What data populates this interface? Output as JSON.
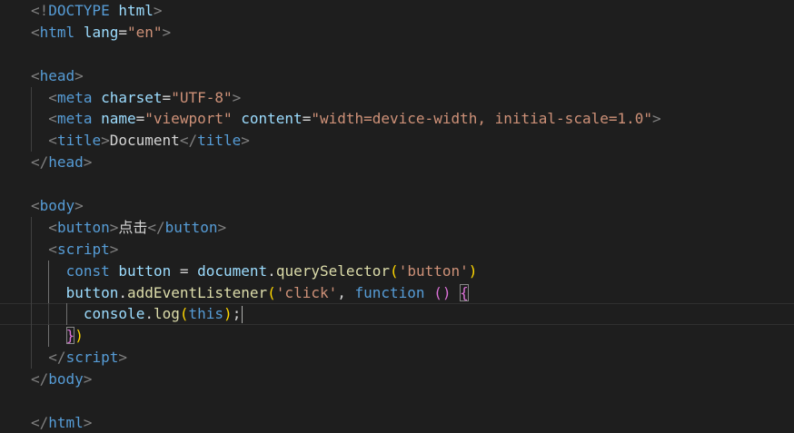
{
  "editor": {
    "lines": [
      {
        "indent": 0,
        "tokens": [
          {
            "t": "<!",
            "c": "tag-bracket"
          },
          {
            "t": "DOCTYPE",
            "c": "tag"
          },
          {
            "t": " ",
            "c": "txt"
          },
          {
            "t": "html",
            "c": "attr"
          },
          {
            "t": ">",
            "c": "tag-bracket"
          }
        ]
      },
      {
        "indent": 0,
        "tokens": [
          {
            "t": "<",
            "c": "tag-bracket"
          },
          {
            "t": "html",
            "c": "tag"
          },
          {
            "t": " ",
            "c": "txt"
          },
          {
            "t": "lang",
            "c": "attr"
          },
          {
            "t": "=",
            "c": "pun"
          },
          {
            "t": "\"en\"",
            "c": "str"
          },
          {
            "t": ">",
            "c": "tag-bracket"
          }
        ]
      },
      {
        "indent": 0,
        "tokens": []
      },
      {
        "indent": 0,
        "tokens": [
          {
            "t": "<",
            "c": "tag-bracket"
          },
          {
            "t": "head",
            "c": "tag"
          },
          {
            "t": ">",
            "c": "tag-bracket"
          }
        ]
      },
      {
        "indent": 1,
        "tokens": [
          {
            "t": "<",
            "c": "tag-bracket"
          },
          {
            "t": "meta",
            "c": "tag"
          },
          {
            "t": " ",
            "c": "txt"
          },
          {
            "t": "charset",
            "c": "attr"
          },
          {
            "t": "=",
            "c": "pun"
          },
          {
            "t": "\"UTF-8\"",
            "c": "str"
          },
          {
            "t": ">",
            "c": "tag-bracket"
          }
        ]
      },
      {
        "indent": 1,
        "tokens": [
          {
            "t": "<",
            "c": "tag-bracket"
          },
          {
            "t": "meta",
            "c": "tag"
          },
          {
            "t": " ",
            "c": "txt"
          },
          {
            "t": "name",
            "c": "attr"
          },
          {
            "t": "=",
            "c": "pun"
          },
          {
            "t": "\"viewport\"",
            "c": "str"
          },
          {
            "t": " ",
            "c": "txt"
          },
          {
            "t": "content",
            "c": "attr"
          },
          {
            "t": "=",
            "c": "pun"
          },
          {
            "t": "\"width=device-width, initial-scale=1.0\"",
            "c": "str"
          },
          {
            "t": ">",
            "c": "tag-bracket"
          }
        ]
      },
      {
        "indent": 1,
        "tokens": [
          {
            "t": "<",
            "c": "tag-bracket"
          },
          {
            "t": "title",
            "c": "tag"
          },
          {
            "t": ">",
            "c": "tag-bracket"
          },
          {
            "t": "Document",
            "c": "txt"
          },
          {
            "t": "</",
            "c": "tag-bracket"
          },
          {
            "t": "title",
            "c": "tag"
          },
          {
            "t": ">",
            "c": "tag-bracket"
          }
        ]
      },
      {
        "indent": 0,
        "tokens": [
          {
            "t": "</",
            "c": "tag-bracket"
          },
          {
            "t": "head",
            "c": "tag"
          },
          {
            "t": ">",
            "c": "tag-bracket"
          }
        ]
      },
      {
        "indent": 0,
        "tokens": []
      },
      {
        "indent": 0,
        "tokens": [
          {
            "t": "<",
            "c": "tag-bracket"
          },
          {
            "t": "body",
            "c": "tag"
          },
          {
            "t": ">",
            "c": "tag-bracket"
          }
        ]
      },
      {
        "indent": 1,
        "tokens": [
          {
            "t": "<",
            "c": "tag-bracket"
          },
          {
            "t": "button",
            "c": "tag"
          },
          {
            "t": ">",
            "c": "tag-bracket"
          },
          {
            "t": "点击",
            "c": "txt"
          },
          {
            "t": "</",
            "c": "tag-bracket"
          },
          {
            "t": "button",
            "c": "tag"
          },
          {
            "t": ">",
            "c": "tag-bracket"
          }
        ]
      },
      {
        "indent": 1,
        "tokens": [
          {
            "t": "<",
            "c": "tag-bracket"
          },
          {
            "t": "script",
            "c": "tag"
          },
          {
            "t": ">",
            "c": "tag-bracket"
          }
        ]
      },
      {
        "indent": 2,
        "tokens": [
          {
            "t": "const",
            "c": "kw"
          },
          {
            "t": " ",
            "c": "txt"
          },
          {
            "t": "button",
            "c": "var"
          },
          {
            "t": " = ",
            "c": "pun"
          },
          {
            "t": "document",
            "c": "var"
          },
          {
            "t": ".",
            "c": "pun"
          },
          {
            "t": "querySelector",
            "c": "fn"
          },
          {
            "t": "(",
            "c": "brace1"
          },
          {
            "t": "'button'",
            "c": "str"
          },
          {
            "t": ")",
            "c": "brace1"
          }
        ]
      },
      {
        "indent": 2,
        "tokens": [
          {
            "t": "button",
            "c": "var"
          },
          {
            "t": ".",
            "c": "pun"
          },
          {
            "t": "addEventListener",
            "c": "fn"
          },
          {
            "t": "(",
            "c": "brace1"
          },
          {
            "t": "'click'",
            "c": "str"
          },
          {
            "t": ", ",
            "c": "pun"
          },
          {
            "t": "function",
            "c": "kw"
          },
          {
            "t": " ",
            "c": "txt"
          },
          {
            "t": "()",
            "c": "brace2"
          },
          {
            "t": " ",
            "c": "txt"
          },
          {
            "t": "{",
            "c": "brace2 brace-match"
          }
        ]
      },
      {
        "indent": 3,
        "current": true,
        "cursor": true,
        "tokens": [
          {
            "t": "console",
            "c": "var"
          },
          {
            "t": ".",
            "c": "pun"
          },
          {
            "t": "log",
            "c": "fn"
          },
          {
            "t": "(",
            "c": "brace1"
          },
          {
            "t": "this",
            "c": "kw"
          },
          {
            "t": ")",
            "c": "brace1"
          },
          {
            "t": ";",
            "c": "pun"
          }
        ]
      },
      {
        "indent": 2,
        "tokens": [
          {
            "t": "}",
            "c": "brace2 brace-match"
          },
          {
            "t": ")",
            "c": "brace1"
          }
        ]
      },
      {
        "indent": 1,
        "tokens": [
          {
            "t": "</",
            "c": "tag-bracket"
          },
          {
            "t": "script",
            "c": "tag"
          },
          {
            "t": ">",
            "c": "tag-bracket"
          }
        ]
      },
      {
        "indent": 0,
        "tokens": [
          {
            "t": "</",
            "c": "tag-bracket"
          },
          {
            "t": "body",
            "c": "tag"
          },
          {
            "t": ">",
            "c": "tag-bracket"
          }
        ]
      },
      {
        "indent": 0,
        "tokens": []
      },
      {
        "indent": 0,
        "tokens": [
          {
            "t": "</",
            "c": "tag-bracket"
          },
          {
            "t": "html",
            "c": "tag"
          },
          {
            "t": ">",
            "c": "tag-bracket"
          }
        ]
      }
    ]
  }
}
